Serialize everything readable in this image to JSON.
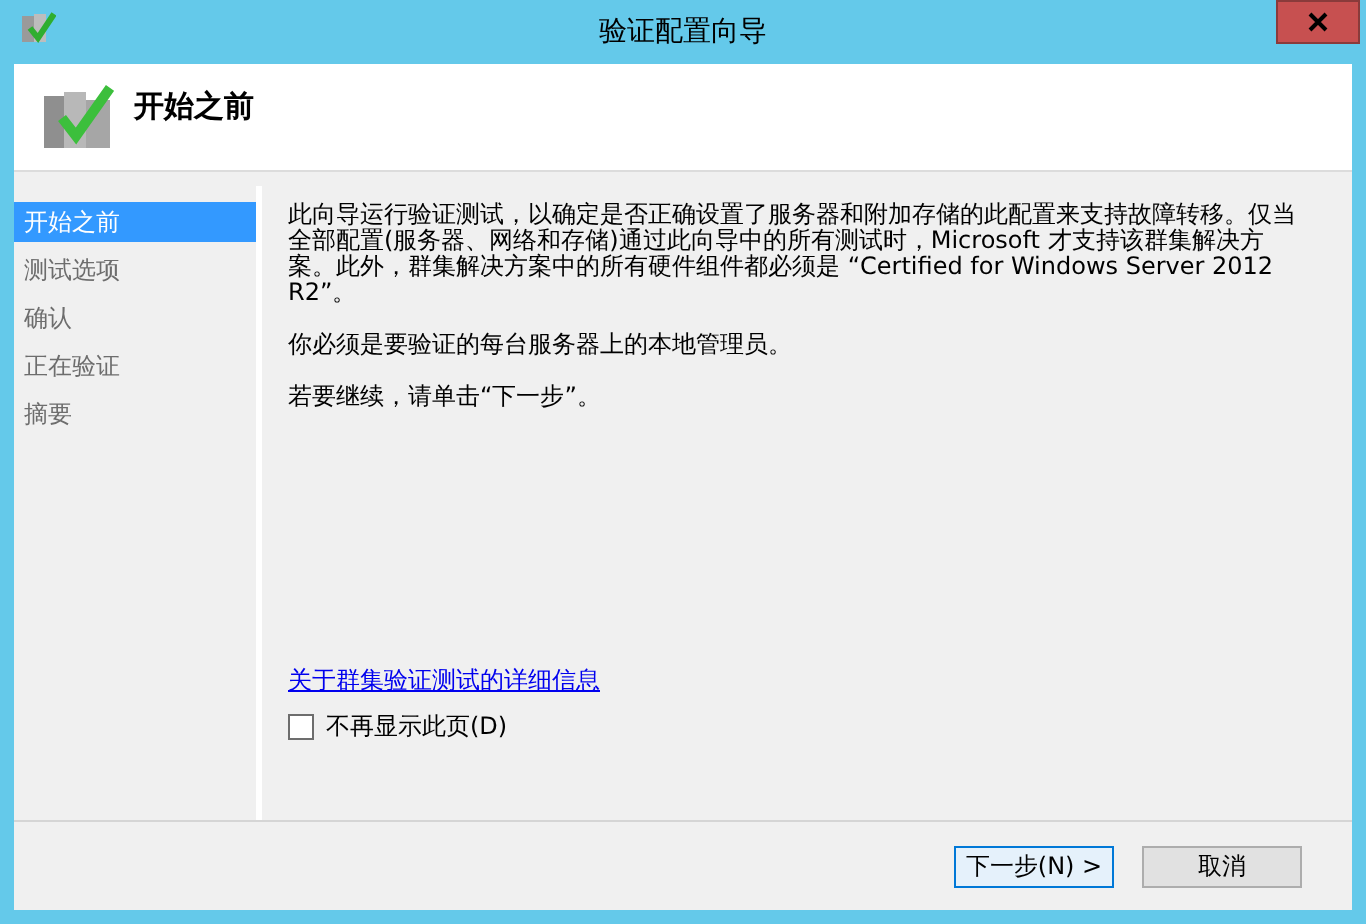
{
  "window": {
    "title": "验证配置向导"
  },
  "header": {
    "title": "开始之前"
  },
  "sidebar": {
    "items": [
      {
        "label": "开始之前",
        "selected": true
      },
      {
        "label": "测试选项",
        "selected": false
      },
      {
        "label": "确认",
        "selected": false
      },
      {
        "label": "正在验证",
        "selected": false
      },
      {
        "label": "摘要",
        "selected": false
      }
    ]
  },
  "content": {
    "paragraphs": [
      "此向导运行验证测试，以确定是否正确设置了服务器和附加存储的此配置来支持故障转移。仅当全部配置(服务器、网络和存储)通过此向导中的所有测试时，Microsoft 才支持该群集解决方案。此外，群集解决方案中的所有硬件组件都必须是 “Certified for Windows Server 2012 R2”。",
      "你必须是要验证的每台服务器上的本地管理员。",
      "若要继续，请单击“下一步”。"
    ],
    "link": "关于群集验证测试的详细信息",
    "checkbox": {
      "label": "不再显示此页(D)",
      "checked": false
    }
  },
  "buttons": [
    {
      "label": "下一步(N) >",
      "default": true
    },
    {
      "label": "取消",
      "default": false
    }
  ]
}
